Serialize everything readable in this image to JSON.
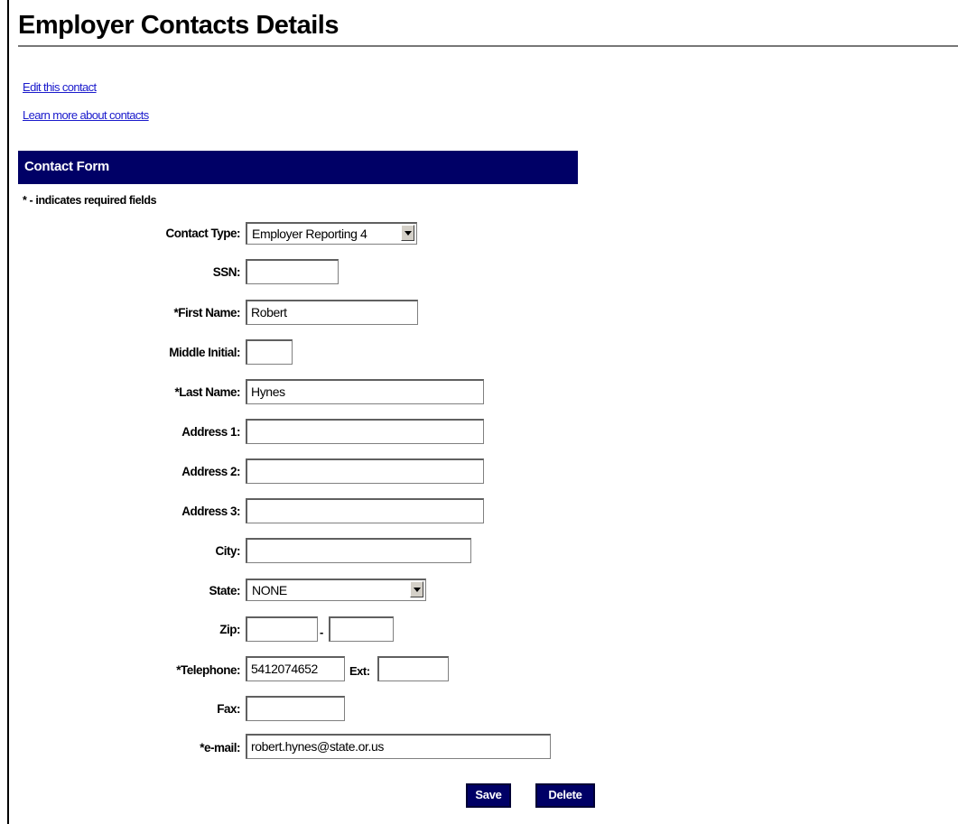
{
  "page": {
    "title": "Employer Contacts Details",
    "links": [
      "Edit this contact",
      "Learn more about contacts"
    ]
  },
  "form": {
    "section_title": "Contact Form",
    "required_note": "* - indicates required fields",
    "fields": {
      "contact_type": {
        "label": "Contact Type:",
        "value": "Employer Reporting 4"
      },
      "ssn": {
        "label": "SSN:",
        "value": ""
      },
      "first_name": {
        "label": "*First Name:",
        "value": "Robert"
      },
      "middle_initial": {
        "label": "Middle Initial:",
        "value": ""
      },
      "last_name": {
        "label": "*Last Name:",
        "value": "Hynes"
      },
      "address1": {
        "label": "Address 1:",
        "value": ""
      },
      "address2": {
        "label": "Address 2:",
        "value": ""
      },
      "address3": {
        "label": "Address 3:",
        "value": ""
      },
      "city": {
        "label": "City:",
        "value": ""
      },
      "state": {
        "label": "State:",
        "value": "NONE"
      },
      "zip": {
        "label": "Zip:",
        "value": "",
        "ext_value": "",
        "separator": "-"
      },
      "telephone": {
        "label": "*Telephone:",
        "value": "5412074652",
        "ext_label": "Ext:",
        "ext_value": ""
      },
      "fax": {
        "label": "Fax:",
        "value": ""
      },
      "email": {
        "label": "*e-mail:",
        "value": "robert.hynes@state.or.us"
      }
    },
    "buttons": {
      "save": "Save",
      "delete": "Delete"
    }
  }
}
